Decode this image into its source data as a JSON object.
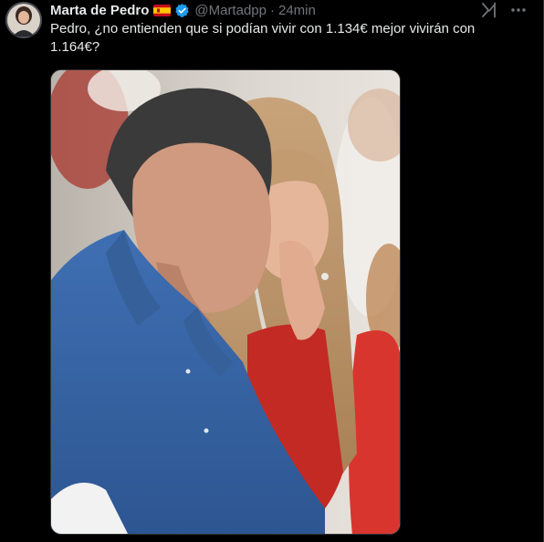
{
  "post": {
    "author_name": "Marta de Pedro",
    "flag_icon": "spain-flag-icon",
    "verified_icon": "verified-badge-icon",
    "handle": "@Martadpp",
    "separator": "·",
    "time": "24min",
    "text": "Pedro, ¿no entienden que si podían vivir con 1.134€ mejor vivirán con 1.164€?",
    "grok_icon": "grok-icon",
    "more_icon": "more-options-icon"
  },
  "colors": {
    "background": "#000000",
    "primary_text": "#e7e9ea",
    "secondary_text": "#71767b",
    "verified_blue": "#1d9bf0"
  }
}
